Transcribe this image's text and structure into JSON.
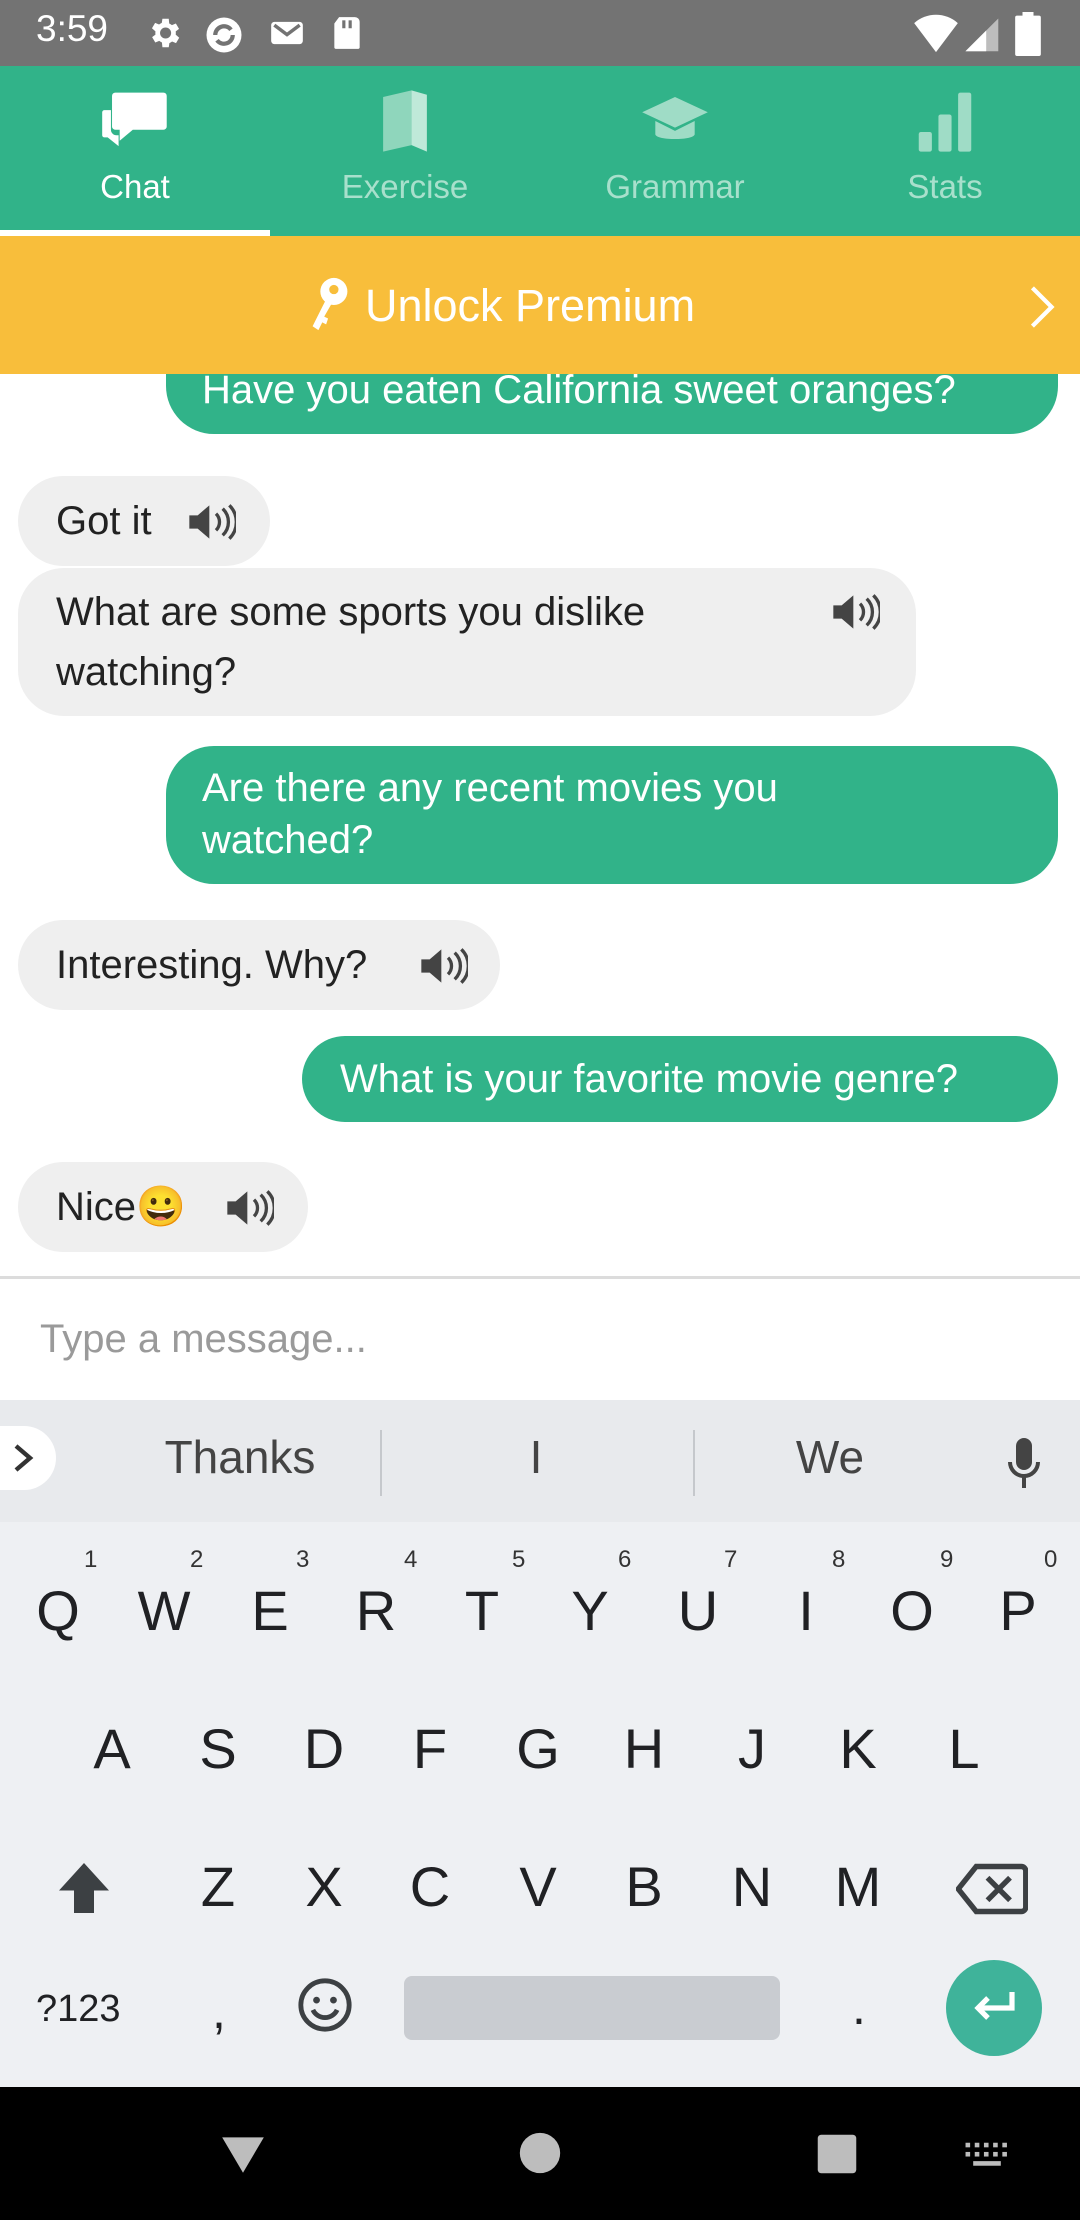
{
  "status_bar": {
    "time": "3:59"
  },
  "tabs": [
    {
      "label": "Chat",
      "active": true
    },
    {
      "label": "Exercise",
      "active": false
    },
    {
      "label": "Grammar",
      "active": false
    },
    {
      "label": "Stats",
      "active": false
    }
  ],
  "premium": {
    "label": "Unlock Premium"
  },
  "messages": [
    {
      "from": "user",
      "text": "Have you eaten California sweet oranges?"
    },
    {
      "from": "bot",
      "text": "Got it"
    },
    {
      "from": "bot",
      "text": "What are some sports you dislike watching?"
    },
    {
      "from": "user",
      "text": "Are there any recent movies you watched?"
    },
    {
      "from": "bot",
      "text": "Interesting. Why?"
    },
    {
      "from": "user",
      "text": "What is your favorite movie genre?"
    },
    {
      "from": "bot",
      "text": "Nice😀"
    }
  ],
  "input": {
    "placeholder": "Type a message..."
  },
  "keyboard": {
    "suggestions": [
      "Thanks",
      "I",
      "We"
    ],
    "row1": [
      "Q",
      "W",
      "E",
      "R",
      "T",
      "Y",
      "U",
      "I",
      "O",
      "P"
    ],
    "row1_numbers": [
      "1",
      "2",
      "3",
      "4",
      "5",
      "6",
      "7",
      "8",
      "9",
      "0"
    ],
    "row2": [
      "A",
      "S",
      "D",
      "F",
      "G",
      "H",
      "J",
      "K",
      "L"
    ],
    "row3": [
      "Z",
      "X",
      "C",
      "V",
      "B",
      "N",
      "M"
    ],
    "symbols_label": "?123",
    "comma": ",",
    "period": "."
  },
  "colors": {
    "accent": "#31b389",
    "premium": "#f8be3b",
    "bot_bubble": "#efefef"
  }
}
